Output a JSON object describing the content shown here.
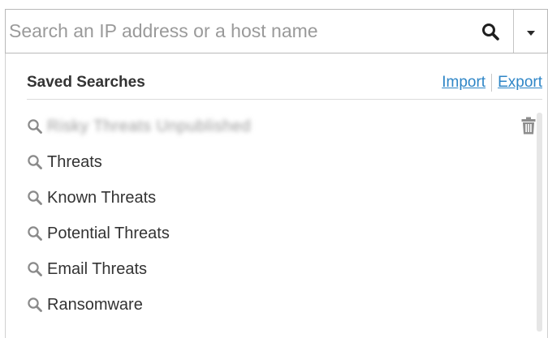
{
  "search": {
    "placeholder": "Search an IP address or a host name",
    "value": ""
  },
  "icons": {
    "search_button": "magnifier-icon",
    "dropdown": "caret-down-icon",
    "item": "magnifier-icon",
    "delete": "trash-icon"
  },
  "saved_searches": {
    "title": "Saved Searches",
    "import_label": "Import",
    "export_label": "Export",
    "items": [
      {
        "label": "Risky Threats Unpublished",
        "blurred": true
      },
      {
        "label": "Threats"
      },
      {
        "label": "Known Threats"
      },
      {
        "label": "Potential Threats"
      },
      {
        "label": "Email Threats"
      },
      {
        "label": "Ransomware"
      }
    ]
  },
  "colors": {
    "link": "#2f86c7",
    "icon": "#8a8a8a",
    "text": "#333333"
  }
}
